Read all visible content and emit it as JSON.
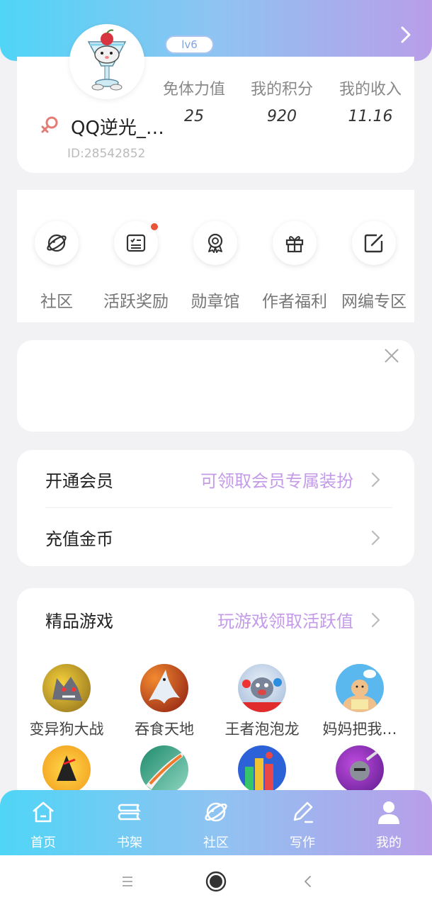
{
  "profile": {
    "level": "lv6",
    "username": "QQ逆光_…",
    "user_id": "ID:28542852",
    "stats": [
      {
        "label": "免体力值",
        "value": "25"
      },
      {
        "label": "我的积分",
        "value": "920"
      },
      {
        "label": "我的收入",
        "value": "11.16"
      }
    ]
  },
  "features": [
    {
      "label": "社区",
      "icon": "planet-icon"
    },
    {
      "label": "活跃奖励",
      "icon": "checklist-icon"
    },
    {
      "label": "勋章馆",
      "icon": "medal-icon"
    },
    {
      "label": "作者福利",
      "icon": "gift-icon"
    },
    {
      "label": "网编专区",
      "icon": "edit-icon"
    }
  ],
  "menu": {
    "vip": {
      "title": "开通会员",
      "subtitle": "可领取会员专属装扮"
    },
    "recharge": {
      "title": "充值金币"
    }
  },
  "games": {
    "title": "精品游戏",
    "subtitle": "玩游戏领取活跃值",
    "items": [
      {
        "name": "变异狗大战"
      },
      {
        "name": "吞食天地"
      },
      {
        "name": "王者泡泡龙"
      },
      {
        "name": "妈妈把我…"
      }
    ]
  },
  "tabs": [
    {
      "label": "首页",
      "icon": "home-icon"
    },
    {
      "label": "书架",
      "icon": "bookshelf-icon"
    },
    {
      "label": "社区",
      "icon": "planet-icon"
    },
    {
      "label": "写作",
      "icon": "pen-icon"
    },
    {
      "label": "我的",
      "icon": "user-icon",
      "active": true
    }
  ],
  "colors": {
    "gradient_start": "#4fd5f6",
    "gradient_end": "#b99ee9",
    "accent_text": "#c49be8",
    "notification_dot": "#e8553a"
  }
}
